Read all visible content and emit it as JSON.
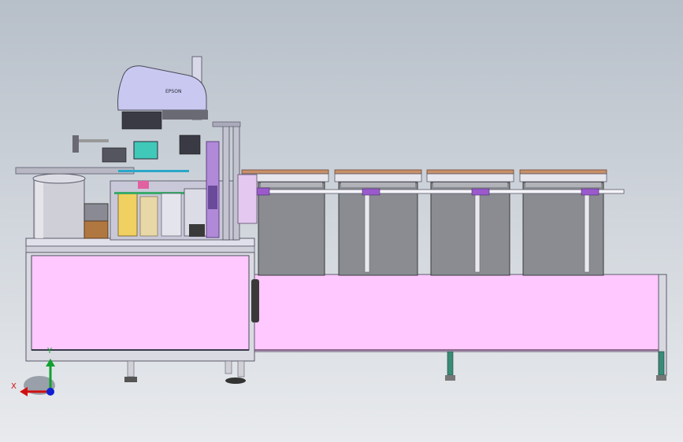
{
  "viewport": {
    "background_top": "#b7bfc9",
    "background_bottom": "#e8eaed"
  },
  "colors": {
    "frame_pink": "#ffc8ff",
    "frame_outline": "#5a5a6a",
    "robot_lavender": "#c8c8f0",
    "bin_gray": "#8a8c92",
    "tray_wood": "#c8906a",
    "bracket_purple": "#9a5acc",
    "conveyor_teal": "#3a8a78"
  },
  "robot": {
    "brand_text": "EPSON"
  },
  "triad": {
    "x_label": "X",
    "y_label": "Y"
  }
}
